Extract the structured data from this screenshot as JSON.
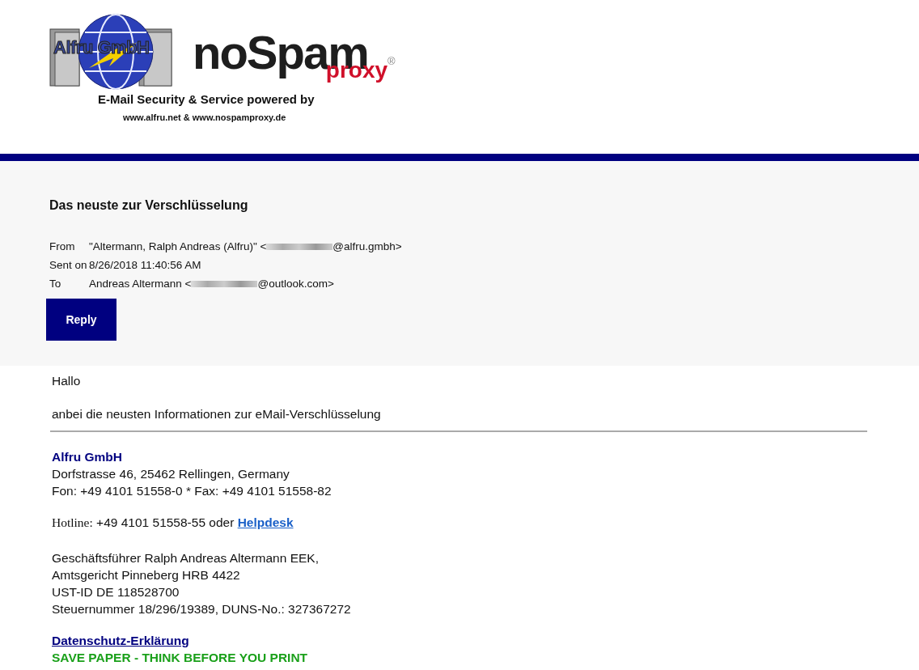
{
  "logo": {
    "company": "Alfru GmbH",
    "product": "noSpam",
    "product_sub": "proxy",
    "mark": "®"
  },
  "banner": {
    "tagline": "E-Mail Security & Service powered by",
    "sites": "www.alfru.net & www.nospamproxy.de"
  },
  "message": {
    "subject": "Das neuste zur Verschlüsselung",
    "headers": [
      {
        "label": "From",
        "before": "\"Altermann, Ralph Andreas (Alfru)\" <",
        "redacted": true,
        "after": "@alfru.gmbh>"
      },
      {
        "label": "Sent on",
        "before": "8/26/2018 11:40:56 AM",
        "redacted": false
      },
      {
        "label": "To",
        "before": "Andreas Altermann <",
        "redacted": true,
        "after": "@outlook.com>"
      }
    ],
    "reply_button": "Reply"
  },
  "body": {
    "greeting": "Hallo",
    "text": "anbei die neusten Informationen zur eMail-Verschlüsselung"
  },
  "signature": {
    "company": "Alfru GmbH",
    "address": [
      "Dorfstrasse 46, 25462 Rellingen, Germany",
      "Fon: +49 4101 51558-0 * Fax: +49 4101 51558-82"
    ],
    "hotline": {
      "label": "Hotline:",
      "text": " +49 4101 51558-55 oder ",
      "link": "Helpdesk"
    },
    "legal": [
      "Geschäftsführer Ralph Andreas Altermann EEK,",
      "Amtsgericht Pinneberg HRB 4422",
      "UST-ID DE 118528700",
      "Steuernummer 18/296/19389, DUNS-No.: 327367272"
    ],
    "privacy_link": "Datenschutz-Erklärung",
    "slogan": "SAVE PAPER - THINK BEFORE YOU PRINT"
  }
}
